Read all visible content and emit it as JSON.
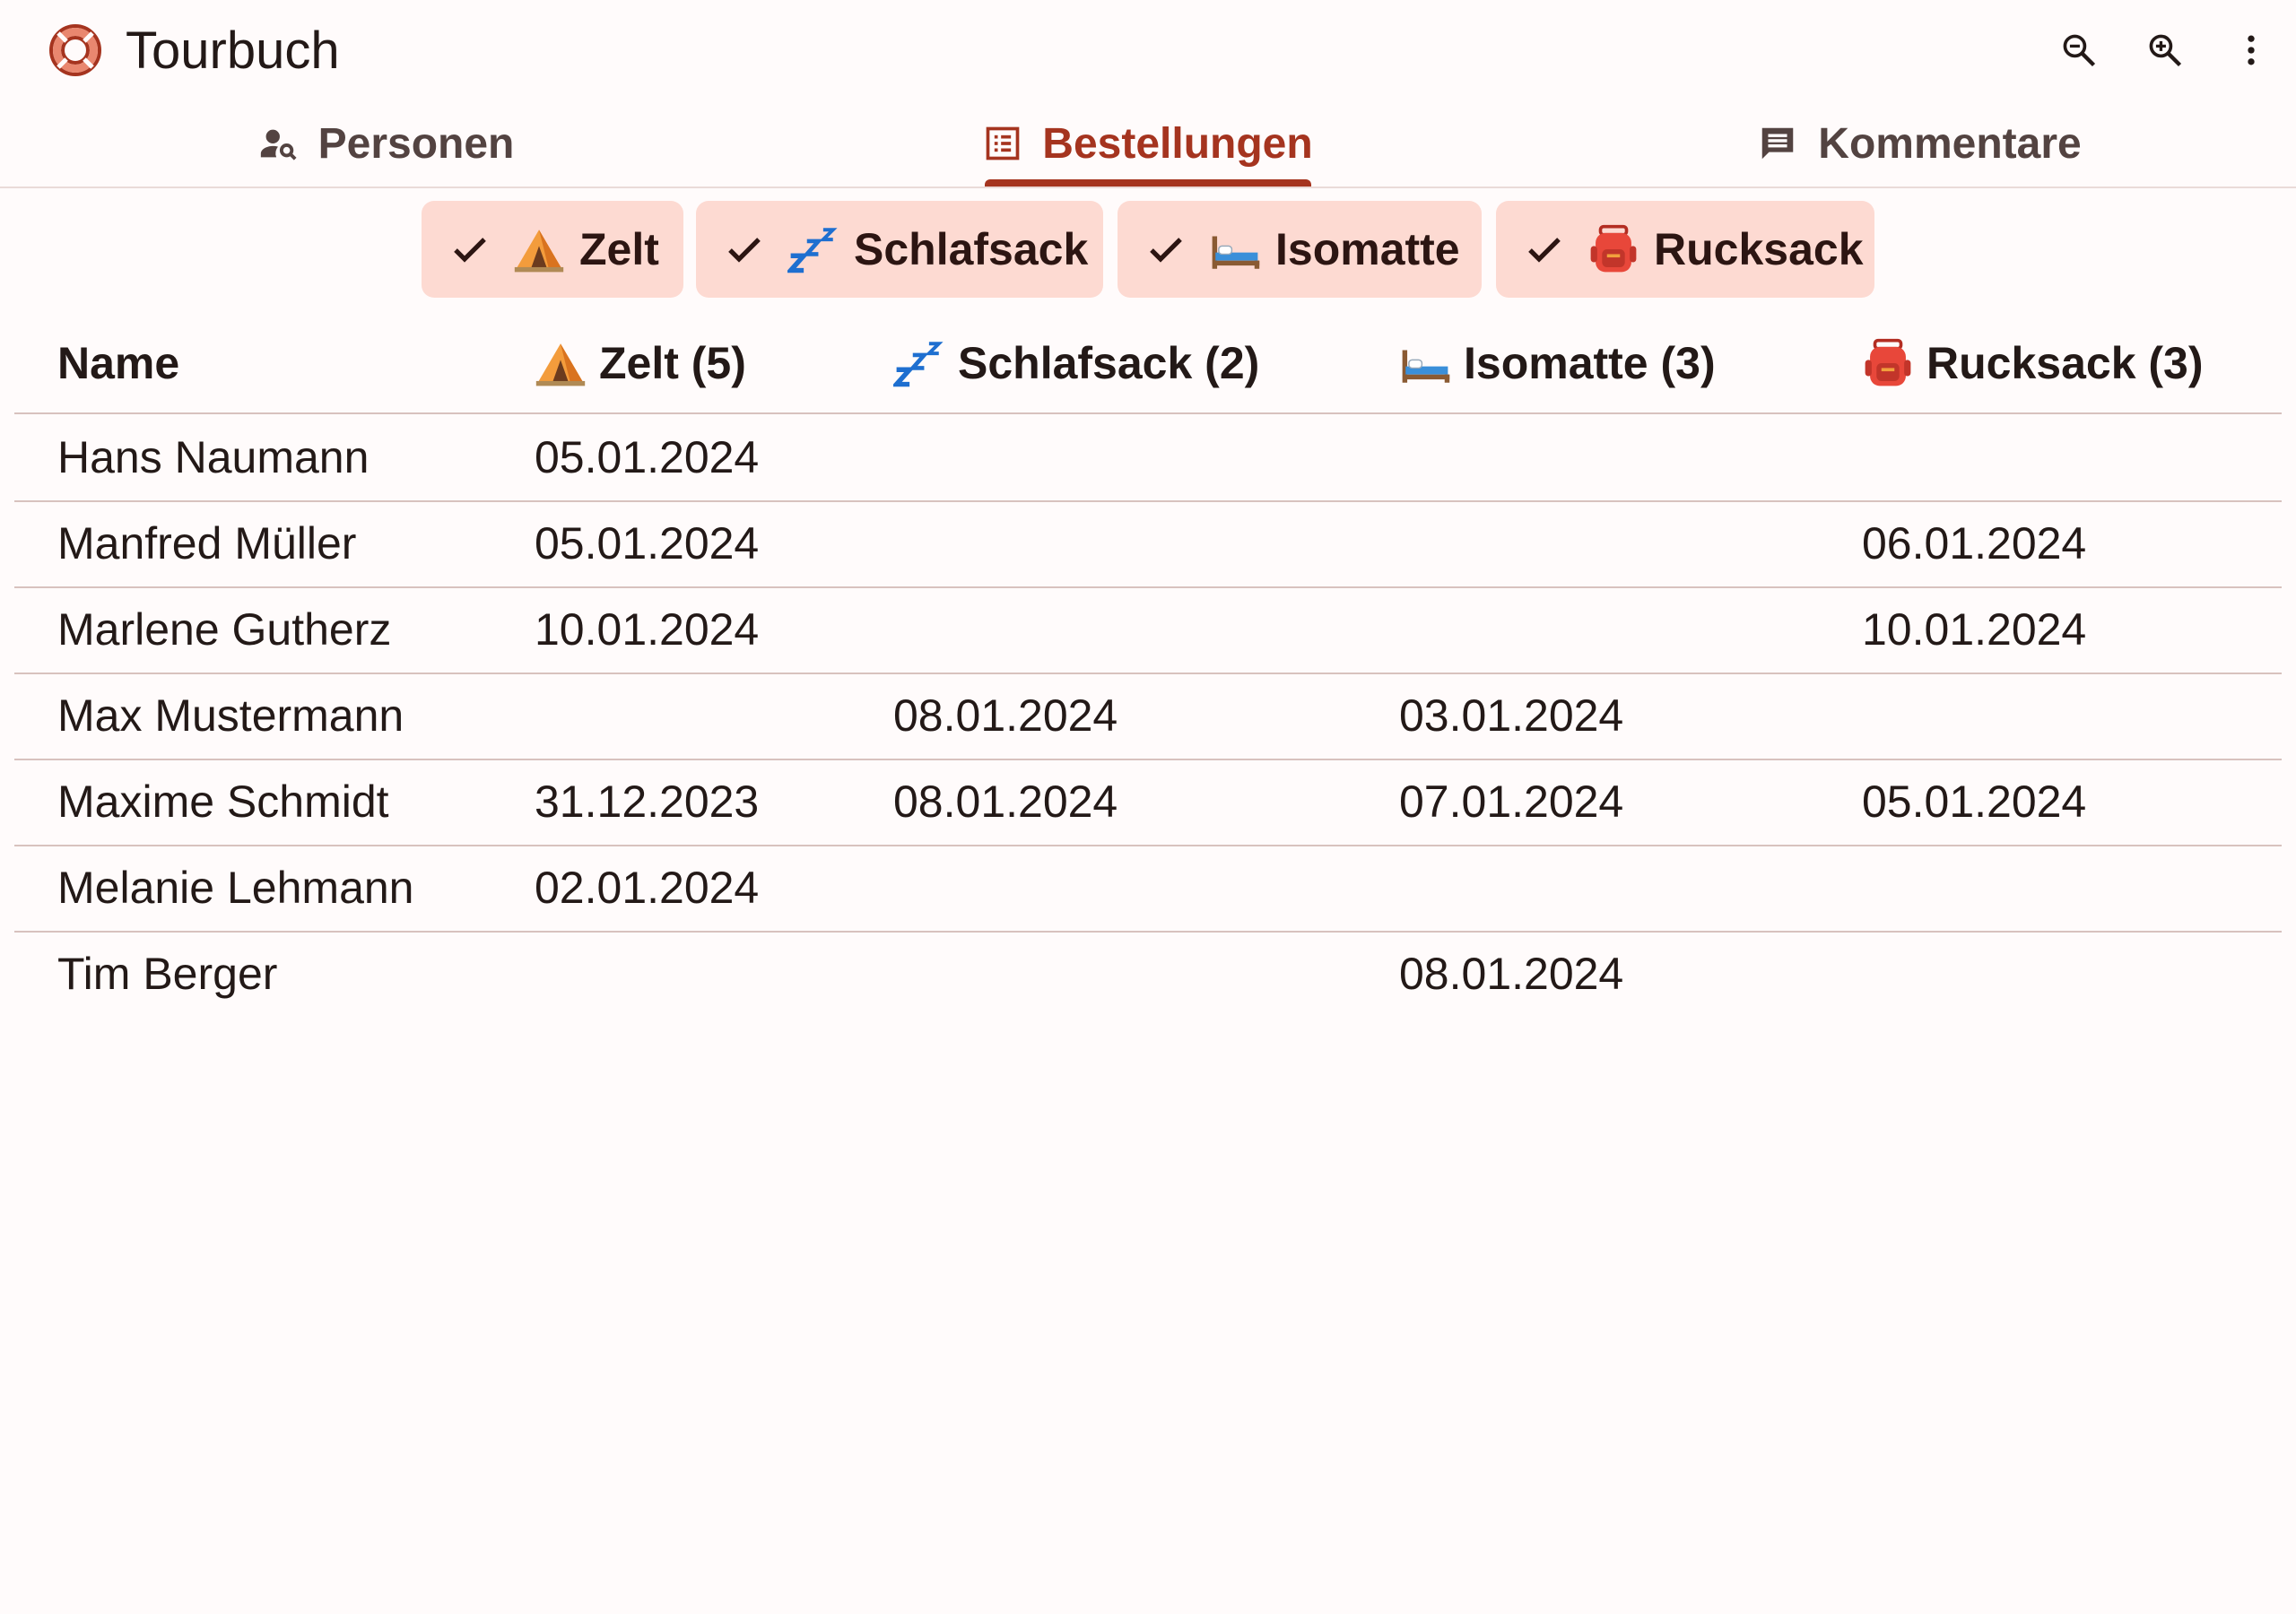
{
  "app": {
    "title": "Tourbuch",
    "logo_icon": "lifebuoy-icon",
    "accent_color": "#a5341f",
    "actions": [
      "zoom-out-icon",
      "zoom-in-icon",
      "more-vert-icon"
    ]
  },
  "tabs": [
    {
      "label": "Personen",
      "icon": "person-search-icon",
      "active": false
    },
    {
      "label": "Bestellungen",
      "icon": "list-alt-icon",
      "active": true
    },
    {
      "label": "Kommentare",
      "icon": "comment-icon",
      "active": false
    }
  ],
  "filters": [
    {
      "label": "Zelt",
      "icon": "tent-emoji",
      "selected": true
    },
    {
      "label": "Schlafsack",
      "icon": "zzz-emoji",
      "selected": true
    },
    {
      "label": "Isomatte",
      "icon": "bed-emoji",
      "selected": true
    },
    {
      "label": "Rucksack",
      "icon": "backpack-emoji",
      "selected": true
    }
  ],
  "table": {
    "columns": [
      {
        "label": "Name",
        "icon": ""
      },
      {
        "label": "Zelt (5)",
        "icon": "tent-emoji"
      },
      {
        "label": "Schlafsack (2)",
        "icon": "zzz-emoji"
      },
      {
        "label": "Isomatte (3)",
        "icon": "bed-emoji"
      },
      {
        "label": "Rucksack (3)",
        "icon": "backpack-emoji"
      }
    ],
    "rows": [
      [
        "Hans Naumann",
        "05.01.2024",
        "",
        "",
        ""
      ],
      [
        "Manfred Müller",
        "05.01.2024",
        "",
        "",
        "06.01.2024"
      ],
      [
        "Marlene Gutherz",
        "10.01.2024",
        "",
        "",
        "10.01.2024"
      ],
      [
        "Max Mustermann",
        "",
        "08.01.2024",
        "03.01.2024",
        ""
      ],
      [
        "Maxime Schmidt",
        "31.12.2023",
        "08.01.2024",
        "07.01.2024",
        "05.01.2024"
      ],
      [
        "Melanie Lehmann",
        "02.01.2024",
        "",
        "",
        ""
      ],
      [
        "Tim Berger",
        "",
        "",
        "08.01.2024",
        ""
      ]
    ]
  }
}
